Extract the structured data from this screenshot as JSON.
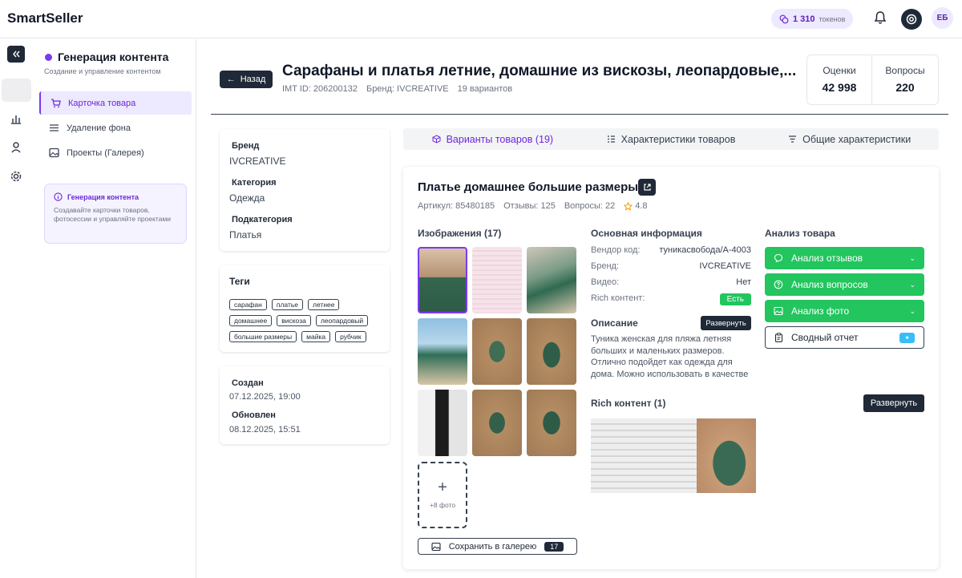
{
  "app": {
    "name": "SmartSeller"
  },
  "topbar": {
    "tokens_value": "1 310",
    "tokens_unit": "токенов",
    "avatar_initials": "ЕБ"
  },
  "sidebar": {
    "title": "Генерация контента",
    "subtitle": "Создание и управление контентом",
    "items": [
      {
        "label": "Карточка товара",
        "icon": "cart-icon"
      },
      {
        "label": "Удаление фона",
        "icon": "lines-icon"
      },
      {
        "label": "Проекты (Галерея)",
        "icon": "image-icon"
      }
    ],
    "info_title": "Генерация контента",
    "info_text": "Создавайте карточки товаров, фотосессии и управляйте проектами"
  },
  "header": {
    "back_label": "Назад",
    "title": "Сарафаны и платья летние, домашние из вискозы, леопардовые,...",
    "imt": "IMT ID: 206200132",
    "brand": "Бренд: IVCREATIVE",
    "variants": "19 вариантов",
    "stats": [
      {
        "label": "Оценки",
        "value": "42 998"
      },
      {
        "label": "Вопросы",
        "value": "220"
      }
    ]
  },
  "left_panel": {
    "brand_label": "Бренд",
    "brand_value": "IVCREATIVE",
    "category_label": "Категория",
    "category_value": "Одежда",
    "subcategory_label": "Подкатегория",
    "subcategory_value": "Платья",
    "tags_title": "Теги",
    "tags": [
      "сарафан",
      "платье",
      "летнее",
      "домашнее",
      "вискоза",
      "леопардовый",
      "большие размеры",
      "майка",
      "рубчик"
    ],
    "created_label": "Создан",
    "created_value": "07.12.2025, 19:00",
    "updated_label": "Обновлен",
    "updated_value": "08.12.2025, 15:51"
  },
  "tabs": [
    {
      "label": "Варианты товаров (19)",
      "active": true
    },
    {
      "label": "Характеристики товаров",
      "active": false
    },
    {
      "label": "Общие характеристики",
      "active": false
    }
  ],
  "product": {
    "title": "Платье домашнее большие размеры",
    "article": "Артикул: 85480185",
    "reviews": "Отзывы: 125",
    "questions": "Вопросы: 22",
    "rating": "4.8",
    "images_title": "Изображения (17)",
    "add_more": "+8 фото",
    "save_label": "Сохранить в галерею",
    "save_count": "17",
    "basic_title": "Основная информация",
    "vendor_label": "Вендор код:",
    "vendor_value": "туникасвобода/А-4003",
    "brand_label": "Бренд:",
    "brand_value": "IVCREATIVE",
    "video_label": "Видео:",
    "video_value": "Нет",
    "rich_label": "Rich контент:",
    "rich_value": "Есть",
    "desc_title": "Описание",
    "expand_label": "Развернуть",
    "description": "Туника женская для пляжа летняя больших и маленьких размеров. Отлично подойдет как одежда для дома. Можно использовать в качестве",
    "rich_title": "Rich контент (1)",
    "analysis_title": "Анализ товара",
    "analysis_buttons": [
      "Анализ отзывов",
      "Анализ вопросов",
      "Анализ фото"
    ],
    "summary_label": "Сводный отчет"
  },
  "colors": {
    "accent": "#7c3aed",
    "green": "#22c55e",
    "dark": "#1f2937"
  }
}
